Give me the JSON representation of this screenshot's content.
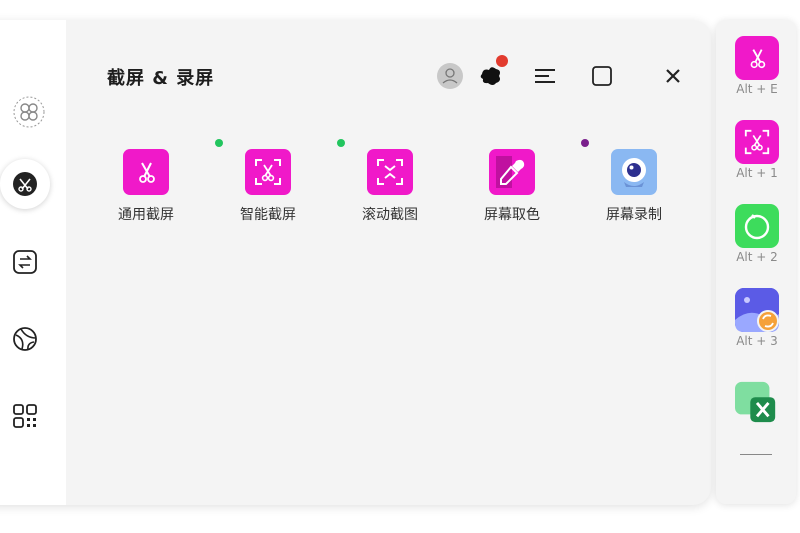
{
  "window": {
    "title": "截屏 & 录屏"
  },
  "sidebar": {
    "items": [
      {
        "icon": "flower-grid-icon",
        "active": false
      },
      {
        "icon": "scissors-icon",
        "active": true
      },
      {
        "icon": "swap-icon",
        "active": false
      },
      {
        "icon": "basketball-icon",
        "active": false
      },
      {
        "icon": "qr-code-icon",
        "active": false
      }
    ]
  },
  "header": {
    "buttons": [
      "avatar-icon",
      "ink-splash-icon",
      "menu-icon",
      "maximize-icon",
      "close-icon"
    ]
  },
  "tools": [
    {
      "label": "通用截屏",
      "icon": "scissors-icon",
      "color": "#f019c9"
    },
    {
      "label": "智能截屏",
      "icon": "smart-scissors-icon",
      "color": "#f019c9",
      "dot": "#22c55e"
    },
    {
      "label": "滚动截图",
      "icon": "scroll-capture-icon",
      "color": "#f019c9",
      "dot": "#22c55e"
    },
    {
      "label": "屏幕取色",
      "icon": "eyedropper-icon",
      "color": "#f019c9"
    },
    {
      "label": "屏幕录制",
      "icon": "webcam-icon",
      "color": "#8ab8f2",
      "dot": "#7a1f8c"
    }
  ],
  "quickbar": [
    {
      "shortcut": "Alt + E",
      "icon": "scissors-icon",
      "color": "#f019c9"
    },
    {
      "shortcut": "Alt + 1",
      "icon": "smart-scissors-icon",
      "color": "#f019c9"
    },
    {
      "shortcut": "Alt + 2",
      "icon": "timer-icon",
      "color": "#3ddc5c"
    },
    {
      "shortcut": "Alt + 3",
      "icon": "image-sync-icon",
      "color": "#5b5be6"
    },
    {
      "shortcut": "",
      "icon": "excel-icon",
      "color": "#1e8c4c"
    }
  ]
}
